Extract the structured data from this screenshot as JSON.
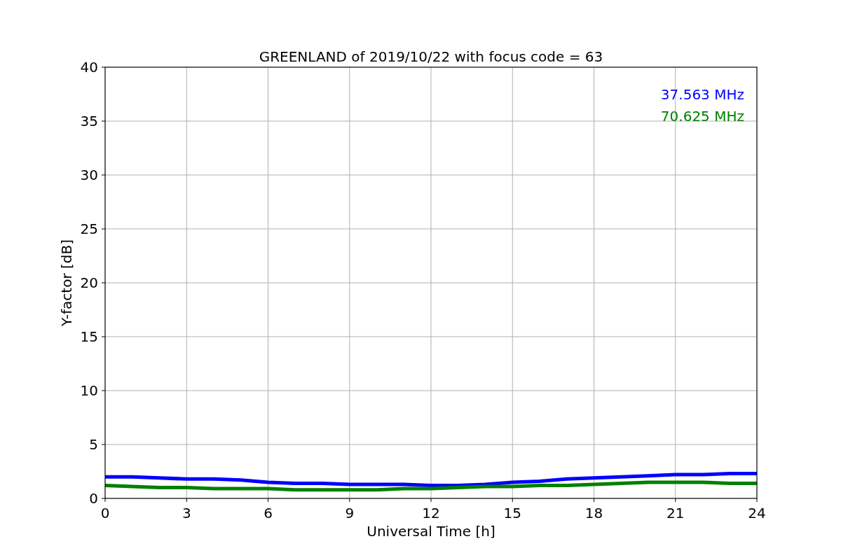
{
  "figure": {
    "chart_data": {
      "type": "line",
      "title": "GREENLAND of 2019/10/22 with focus code = 63",
      "xlabel": "Universal Time [h]",
      "ylabel": "Y-factor [dB]",
      "x": [
        0,
        1,
        2,
        3,
        4,
        5,
        6,
        7,
        8,
        9,
        10,
        11,
        12,
        13,
        14,
        15,
        16,
        17,
        18,
        19,
        20,
        21,
        22,
        23,
        24
      ],
      "series": [
        {
          "name": "37.563 MHz",
          "color": "#0000ff",
          "values": [
            2.0,
            2.0,
            1.9,
            1.8,
            1.8,
            1.7,
            1.5,
            1.4,
            1.4,
            1.3,
            1.3,
            1.3,
            1.2,
            1.2,
            1.3,
            1.5,
            1.6,
            1.8,
            1.9,
            2.0,
            2.1,
            2.2,
            2.2,
            2.3,
            2.3
          ]
        },
        {
          "name": "70.625 MHz",
          "color": "#008000",
          "values": [
            1.2,
            1.1,
            1.0,
            1.0,
            0.9,
            0.9,
            0.9,
            0.8,
            0.8,
            0.8,
            0.8,
            0.9,
            0.9,
            1.0,
            1.1,
            1.1,
            1.2,
            1.2,
            1.3,
            1.4,
            1.5,
            1.5,
            1.5,
            1.4,
            1.4
          ]
        }
      ],
      "xlim": [
        0,
        24
      ],
      "ylim": [
        0,
        40
      ],
      "xticks": [
        0,
        3,
        6,
        9,
        12,
        15,
        18,
        21,
        24
      ],
      "yticks": [
        0,
        5,
        10,
        15,
        20,
        25,
        30,
        35,
        40
      ],
      "grid": true
    }
  }
}
